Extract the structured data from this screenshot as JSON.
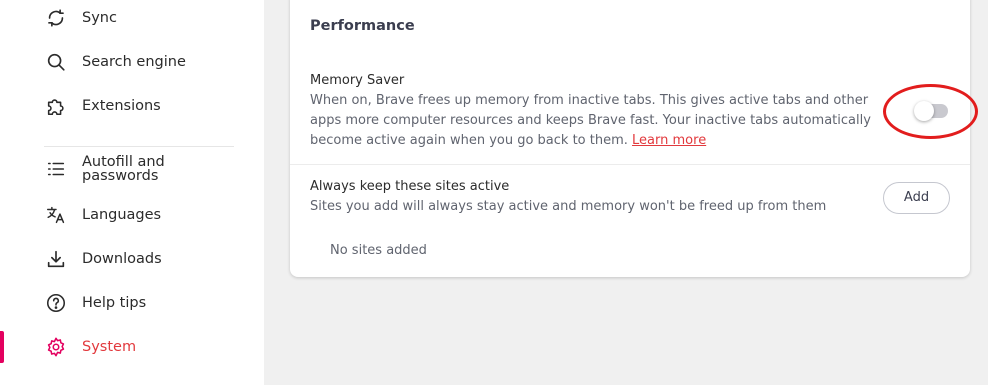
{
  "sidebar": {
    "items": [
      {
        "id": "sync",
        "label": "Sync",
        "icon": "sync-icon"
      },
      {
        "id": "search-engine",
        "label": "Search engine",
        "icon": "search-icon"
      },
      {
        "id": "extensions",
        "label": "Extensions",
        "icon": "puzzle-icon"
      },
      {
        "id": "autofill",
        "label": "Autofill and passwords",
        "icon": "list-icon"
      },
      {
        "id": "languages",
        "label": "Languages",
        "icon": "translate-icon"
      },
      {
        "id": "downloads",
        "label": "Downloads",
        "icon": "download-icon"
      },
      {
        "id": "help-tips",
        "label": "Help tips",
        "icon": "help-icon"
      },
      {
        "id": "system",
        "label": "System",
        "icon": "gear-icon",
        "active": true
      }
    ]
  },
  "performance": {
    "title": "Performance",
    "memory_saver": {
      "title": "Memory Saver",
      "description": "When on, Brave frees up memory from inactive tabs. This gives active tabs and other apps more computer resources and keeps Brave fast. Your inactive tabs automatically become active again when you go back to them.",
      "learn_more": "Learn more",
      "enabled": false
    },
    "always_active": {
      "title": "Always keep these sites active",
      "description": "Sites you add will always stay active and memory won't be freed up from them",
      "add_label": "Add",
      "empty_text": "No sites added"
    }
  },
  "colors": {
    "accent": "#e2393d",
    "active_bar": "#e3005f",
    "highlight_ring": "#e21d1d"
  }
}
